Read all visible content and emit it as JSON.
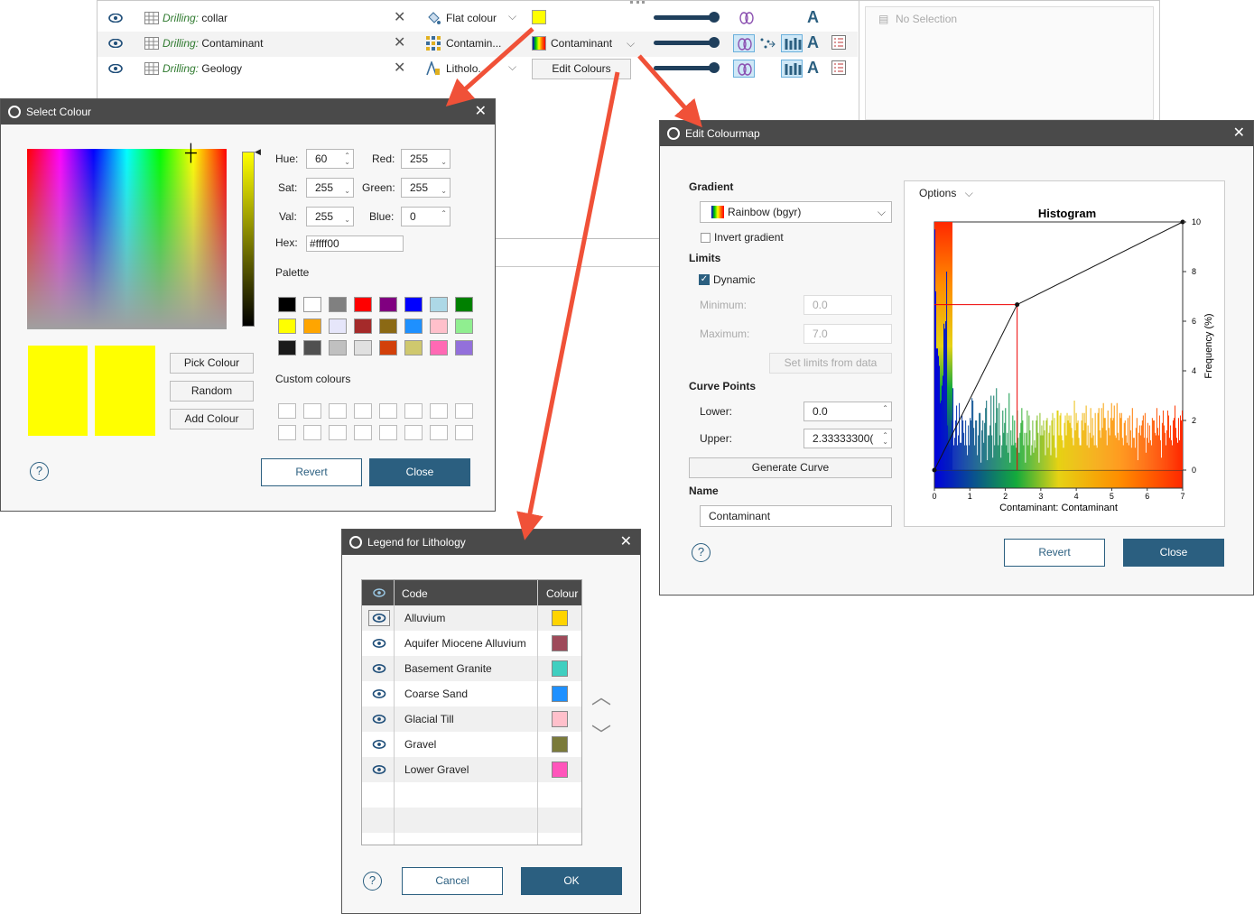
{
  "bg": {
    "rows": [
      {
        "prefix": "Drilling:",
        "name": "collar",
        "mode": "Flat colour",
        "colour_swatch": "#ffff00"
      },
      {
        "prefix": "Drilling:",
        "name": "Contaminant",
        "mode": "Contamin...",
        "colourmap": "Contaminant"
      },
      {
        "prefix": "Drilling:",
        "name": "Geology",
        "mode": "Litholo...",
        "colourmap": "Edit Colours"
      }
    ],
    "no_selection": "No Selection"
  },
  "select_colour": {
    "title": "Select Colour",
    "hue_label": "Hue:",
    "hue": "60",
    "sat_label": "Sat:",
    "sat": "255",
    "val_label": "Val:",
    "val": "255",
    "red_label": "Red:",
    "red": "255",
    "green_label": "Green:",
    "green": "255",
    "blue_label": "Blue:",
    "blue": "0",
    "hex_label": "Hex:",
    "hex": "#ffff00",
    "palette_label": "Palette",
    "palette": [
      "#000000",
      "#ffffff",
      "#808080",
      "#ff0000",
      "#800080",
      "#0000ff",
      "#add8e6",
      "#008000",
      "#ffff00",
      "#ffa500",
      "#e6e6fa",
      "#a52a2a",
      "#8b6914",
      "#1e90ff",
      "#ffc0cb",
      "#90ee90",
      "#1a1a1a",
      "#505050",
      "#c0c0c0",
      "#e0e0e0",
      "#d2400a",
      "#cfc86e",
      "#ff69b4",
      "#9370db"
    ],
    "custom_label": "Custom colours",
    "pick_colour": "Pick Colour",
    "random": "Random",
    "add_colour": "Add Colour",
    "revert": "Revert",
    "close": "Close",
    "current_colour": "#ffff00",
    "new_colour": "#ffff00"
  },
  "edit_colourmap": {
    "title": "Edit Colourmap",
    "gradient_label": "Gradient",
    "gradient_value": "Rainbow (bgyr)",
    "invert_label": "Invert gradient",
    "limits_label": "Limits",
    "dynamic_label": "Dynamic",
    "minimum_label": "Minimum:",
    "minimum": "0.0",
    "maximum_label": "Maximum:",
    "maximum": "7.0",
    "set_limits": "Set limits from data",
    "curve_points_label": "Curve Points",
    "lower_label": "Lower:",
    "lower": "0.0",
    "upper_label": "Upper:",
    "upper": "2.33333300(",
    "generate_curve": "Generate Curve",
    "name_label": "Name",
    "name_value": "Contaminant",
    "options": "Options",
    "revert": "Revert",
    "close": "Close"
  },
  "legend": {
    "title": "Legend for Lithology",
    "col_code": "Code",
    "col_colour": "Colour",
    "items": [
      {
        "code": "Alluvium",
        "colour": "#ffd400"
      },
      {
        "code": "Aquifer Miocene Alluvium",
        "colour": "#9e4a5a"
      },
      {
        "code": "Basement Granite",
        "colour": "#40cfc0"
      },
      {
        "code": "Coarse Sand",
        "colour": "#1e90ff"
      },
      {
        "code": "Glacial Till",
        "colour": "#ffc0cb"
      },
      {
        "code": "Gravel",
        "colour": "#7a7a3a"
      },
      {
        "code": "Lower Gravel",
        "colour": "#ff55bb"
      }
    ],
    "cancel": "Cancel",
    "ok": "OK"
  },
  "chart_data": {
    "type": "bar",
    "title": "Histogram",
    "xlabel": "Contaminant: Contaminant",
    "ylabel": "Frequency (%)",
    "xlim": [
      0,
      7
    ],
    "ylim": [
      0,
      10
    ],
    "x_ticks": [
      "0",
      "1",
      "2",
      "3",
      "4",
      "5",
      "6",
      "7"
    ],
    "y_ticks": [
      "0",
      "2",
      "4",
      "6",
      "8",
      "10"
    ],
    "bin_width": 0.2,
    "values": [
      9.7,
      7.2,
      4.9,
      4.9,
      4.6,
      4.2,
      2.7,
      2.8,
      3.4,
      3.8,
      5.9,
      5.7,
      6.0,
      8.0,
      1.8,
      1.2,
      1.0,
      0.7,
      1.4,
      2.0,
      3.3,
      1.0,
      1.3,
      2.0,
      2.6,
      1.0,
      1.4,
      2.7,
      1.1,
      1.1,
      2.2,
      2.0,
      1.5,
      1.0,
      2.0,
      1.0,
      0.6,
      1.8,
      1.0,
      2.1,
      2.0,
      2.9,
      2.8,
      1.7,
      1.0,
      2.0,
      2.0,
      0.6,
      1.4,
      2.3,
      2.3,
      0.3,
      1.6,
      2.0,
      1.1,
      1.9,
      2.5,
      2.8,
      0.4,
      1.4,
      1.4,
      1.8,
      3.0,
      1.4,
      0.5,
      3.0,
      1.0,
      1.9,
      3.3,
      2.5,
      1.0,
      2.7,
      1.4,
      0.5,
      1.0,
      2.4,
      1.5,
      1.9,
      2.5,
      1.0,
      1.5,
      0.7,
      3.1,
      0.3,
      1.6,
      1.0,
      2.2,
      1.0,
      2.0,
      1.1,
      0.9,
      2.4,
      1.3,
      0.7,
      1.5,
      1.9,
      2.5,
      2.0,
      1.0,
      1.5,
      0.3,
      1.5,
      2.4,
      1.0,
      2.2,
      1.6,
      0.6,
      1.0,
      2.0,
      0.7,
      1.2,
      0.9,
      2.0,
      2.2,
      1.5,
      0.3,
      2.3,
      1.4,
      1.8,
      1.4,
      2.0,
      1.6,
      0.6,
      2.0,
      2.1,
      0.9,
      1.5,
      1.8,
      0.6,
      2.0,
      2.3,
      1.4,
      2.1,
      0.9,
      0.5,
      2.4,
      2.4,
      1.4,
      2.2,
      2.3,
      1.4,
      1.2,
      0.9,
      1.9,
      2.2,
      1.4,
      2.3,
      2.0,
      2.2,
      1.9,
      2.2,
      1.7,
      1.3,
      1.0,
      2.8,
      1.6,
      2.3,
      1.9,
      2.0,
      1.3,
      1.0,
      1.0,
      2.0,
      2.3,
      1.6,
      2.3,
      1.9,
      2.6,
      1.0,
      1.8,
      0.9,
      1.5,
      2.5,
      1.3,
      2.1,
      1.4,
      1.0,
      2.3,
      1.0,
      0.9,
      2.3,
      2.5,
      1.6,
      1.3,
      2.5,
      1.7,
      2.7,
      2.1,
      2.1,
      1.6,
      1.0,
      2.4,
      1.7,
      1.4,
      2.1,
      2.7,
      2.0,
      2.1,
      2.6,
      1.4,
      1.3,
      2.7,
      1.5,
      1.2,
      2.3,
      2.1,
      2.3,
      1.3,
      1.0,
      1.9,
      2.0,
      1.4,
      1.1,
      2.1,
      1.0,
      2.2,
      1.6,
      0.9,
      2.5,
      1.3,
      1.3,
      0.9,
      1.7,
      2.1,
      0.4,
      1.5,
      1.8,
      1.4,
      1.8,
      2.0,
      2.2,
      1.3,
      2.3,
      0.7,
      1.3,
      1.9,
      1.1,
      1.8,
      1.2,
      1.0,
      2.1,
      2.0,
      2.0,
      1.5,
      1.4,
      2.5,
      1.7,
      1.4,
      2.2,
      1.2,
      0.5,
      1.9,
      2.4,
      1.8,
      1.5,
      1.0,
      1.6,
      2.4,
      2.2,
      1.3,
      1.8,
      1.2,
      1.0,
      2.0,
      2.1,
      2.6,
      1.7,
      1.3,
      1.1,
      2.1,
      1.2,
      2.2,
      2.0,
      2.4
    ],
    "curve": [
      [
        0,
        0
      ],
      [
        2.333,
        6.67
      ],
      [
        7,
        10
      ]
    ]
  }
}
